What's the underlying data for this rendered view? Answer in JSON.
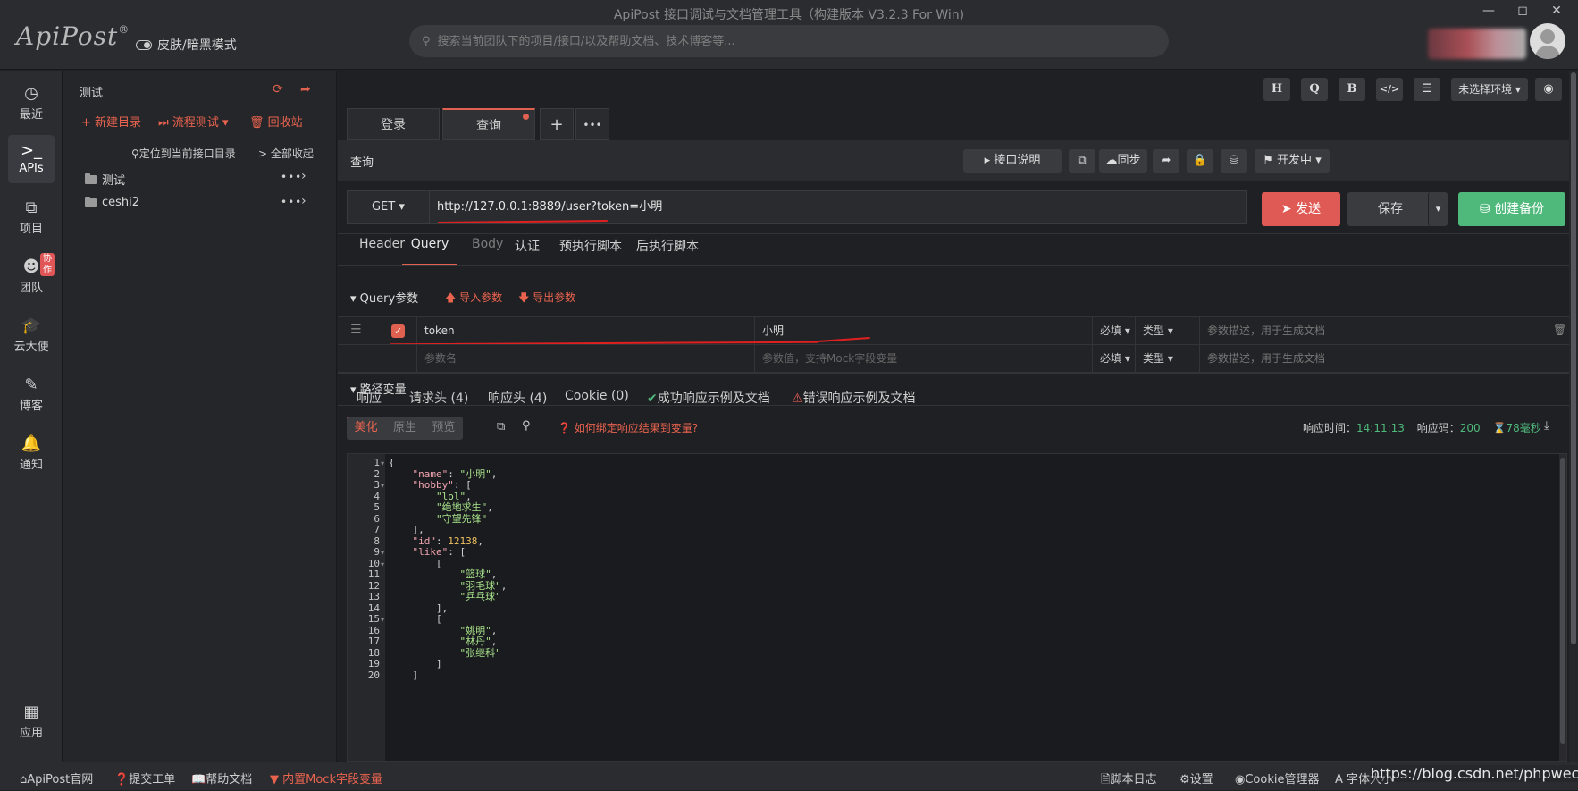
{
  "app": {
    "title": "ApiPost 接口调试与文档管理工具（构建版本 V3.2.3 For Win)",
    "logo": "ApiPost",
    "logo_mark": "®",
    "theme_label": "皮肤/暗黑模式",
    "search_placeholder": "搜索当前团队下的项目/接口/以及帮助文档、技术博客等..."
  },
  "nav": [
    {
      "label": "最近",
      "icon": "clock-icon"
    },
    {
      "label": "APIs",
      "icon": "terminal-icon"
    },
    {
      "label": "项目",
      "icon": "project-icon"
    },
    {
      "label": "团队",
      "icon": "team-icon",
      "badge": "协作"
    },
    {
      "label": "云大使",
      "icon": "graduation-cap-icon"
    },
    {
      "label": "博客",
      "icon": "edit-icon"
    },
    {
      "label": "通知",
      "icon": "bell-icon"
    },
    {
      "label": "应用",
      "icon": "apps-icon"
    }
  ],
  "tree": {
    "title": "测试",
    "new_dir": "新建目录",
    "flow_test": "流程测试",
    "recycle": "回收站",
    "locate": "定位到当前接口目录",
    "collapse": "全部收起",
    "folders": [
      "测试",
      "ceshi2"
    ]
  },
  "toolbar": {
    "h": "H",
    "q": "Q",
    "b": "B",
    "code": "</>",
    "env": "未选择环境"
  },
  "tabs": [
    "登录",
    "查询"
  ],
  "request": {
    "name": "查询",
    "doc_label": "接口说明",
    "sync_label": "同步",
    "status_label": "开发中",
    "method": "GET",
    "url": "http://127.0.0.1:8889/user?token=小明",
    "send": "发送",
    "save": "保存",
    "backup": "创建备份"
  },
  "subtabs": [
    "Header",
    "Query",
    "Body",
    "认证",
    "预执行脚本",
    "后执行脚本"
  ],
  "query": {
    "section": "Query参数",
    "import": "导入参数",
    "export": "导出参数",
    "rows": [
      {
        "key": "token",
        "value": "小明",
        "required": "必填",
        "type": "类型",
        "desc_placeholder": "参数描述，用于生成文档"
      }
    ],
    "key_placeholder": "参数名",
    "value_placeholder": "参数值，支持Mock字段变量",
    "required": "必填",
    "type": "类型",
    "desc_placeholder": "参数描述，用于生成文档"
  },
  "path_vars": "路径变量",
  "response": {
    "tabs": [
      "响应",
      "请求头 (4)",
      "响应头 (4)",
      "Cookie (0)",
      "成功响应示例及文档",
      "错误响应示例及文档"
    ],
    "modes": [
      "美化",
      "原生",
      "预览"
    ],
    "bind_tip": "如何绑定响应结果到变量?",
    "time_label": "响应时间：",
    "time": "14:11:13",
    "code_label": "响应码：",
    "code": "200",
    "duration": "78毫秒"
  },
  "code_lines": [
    {
      "n": "1",
      "t": "{",
      "f": true
    },
    {
      "n": "2",
      "t": "    \"name\": \"小明\","
    },
    {
      "n": "3",
      "t": "    \"hobby\": [",
      "f": true
    },
    {
      "n": "4",
      "t": "        \"lol\","
    },
    {
      "n": "5",
      "t": "        \"绝地求生\","
    },
    {
      "n": "6",
      "t": "        \"守望先锋\""
    },
    {
      "n": "7",
      "t": "    ],"
    },
    {
      "n": "8",
      "t": "    \"id\": 12138,"
    },
    {
      "n": "9",
      "t": "    \"like\": [",
      "f": true
    },
    {
      "n": "10",
      "t": "        [",
      "f": true
    },
    {
      "n": "11",
      "t": "            \"篮球\","
    },
    {
      "n": "12",
      "t": "            \"羽毛球\","
    },
    {
      "n": "13",
      "t": "            \"乒乓球\""
    },
    {
      "n": "14",
      "t": "        ],"
    },
    {
      "n": "15",
      "t": "        [",
      "f": true
    },
    {
      "n": "16",
      "t": "            \"姚明\","
    },
    {
      "n": "17",
      "t": "            \"林丹\","
    },
    {
      "n": "18",
      "t": "            \"张继科\""
    },
    {
      "n": "19",
      "t": "        ]"
    },
    {
      "n": "20",
      "t": "    ]"
    }
  ],
  "footer": {
    "site": "ApiPost官网",
    "ticket": "提交工单",
    "help": "帮助文档",
    "mock": "内置Mock字段变量",
    "script_log": "脚本日志",
    "settings": "设置",
    "cookie": "Cookie管理器",
    "font": "字体大小",
    "watermark": "https://blog.csdn.net/phpwechat"
  },
  "colors": {
    "accent": "#e0614f",
    "send": "#e05a55",
    "backup": "#4fb97c",
    "bg": "#1f2023"
  }
}
